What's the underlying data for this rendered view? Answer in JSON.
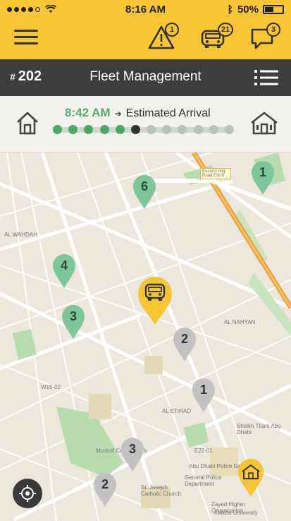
{
  "status_bar": {
    "time": "8:16 AM",
    "battery": "50%"
  },
  "toolbar": {
    "alerts_badge": "1",
    "vehicles_badge": "21",
    "messages_badge": "3"
  },
  "header": {
    "route_hash": "#",
    "route_number": "202",
    "title": "Fleet Management"
  },
  "arrival": {
    "time": "8:42 AM",
    "label": "Estimated Arrival",
    "stops_total": 12,
    "stops_completed": 5,
    "current_stop": 6
  },
  "map": {
    "pins_upcoming": [
      {
        "label": "1"
      },
      {
        "label": "6"
      },
      {
        "label": "4"
      },
      {
        "label": "3"
      }
    ],
    "pins_completed": [
      {
        "label": "2"
      },
      {
        "label": "1"
      },
      {
        "label": "3"
      },
      {
        "label": "2"
      }
    ],
    "labels": {
      "al_wahdah": "AL WAHDAH",
      "al_nahyan": "AL NAHYAN",
      "al_ethad": "AL ETIHAD",
      "w15": "W15-02",
      "e22": "E22-01",
      "mushrif": "Mushrif Central Park",
      "st_joseph": "St. Joseph Catholic Church",
      "police": "Abu Dhabi Police Gen",
      "police2": "General Police Department",
      "zayed": "Zayed Higher Organization",
      "khalifa": "Khalifa University",
      "sheikh": "Sheikh Thani Abu Dhabi",
      "eastern_ring": "Eastern ring Road Exit 6"
    },
    "colors": {
      "upcoming": "#7dc69a",
      "completed": "#bdbdbd",
      "bus": "#f6c534",
      "highway": "#f2a33a"
    }
  },
  "icons": [
    "hamburger-icon",
    "alert-icon",
    "bus-icon",
    "chat-icon",
    "list-icon",
    "school-icon",
    "home-icon",
    "locate-icon"
  ]
}
